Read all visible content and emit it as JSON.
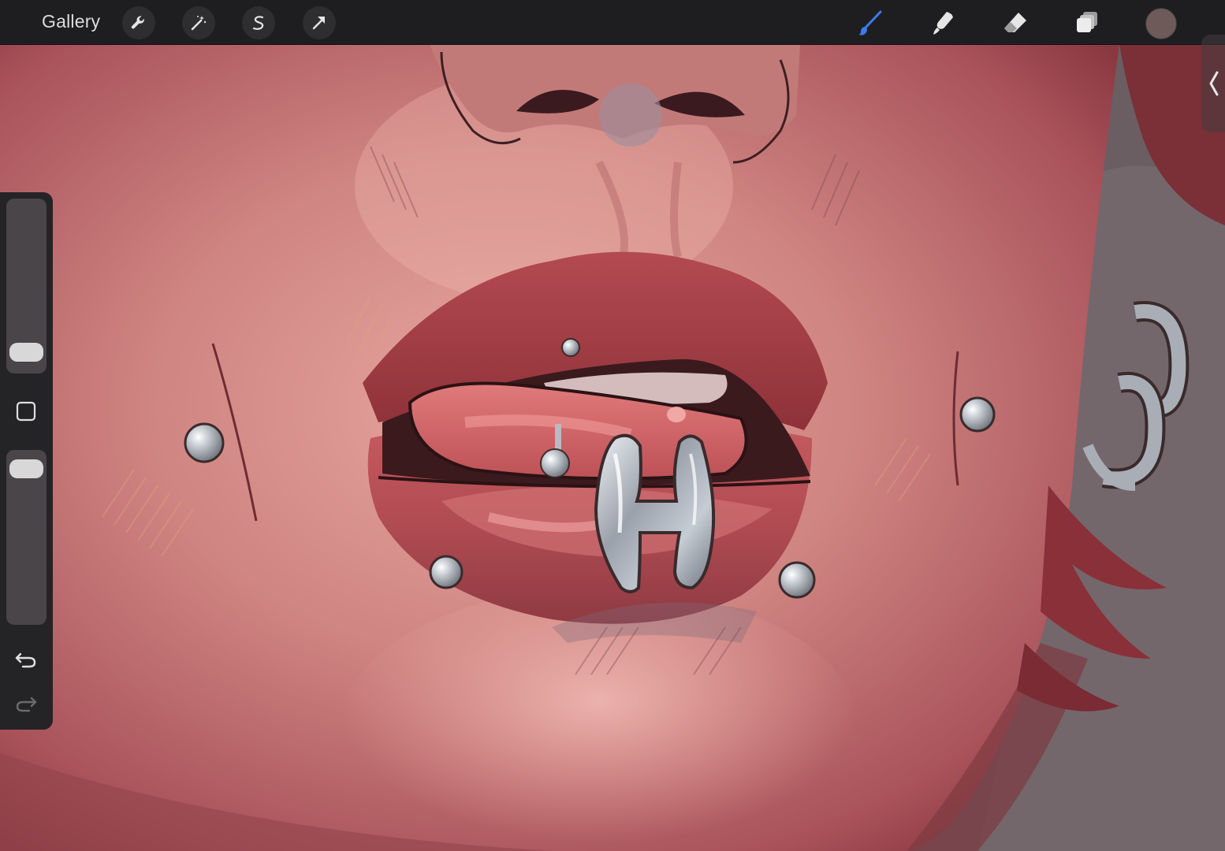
{
  "topbar": {
    "gallery_label": "Gallery",
    "left_tools": [
      "actions-icon",
      "adjustments-icon",
      "selection-icon",
      "transform-icon"
    ],
    "right_tools": [
      "brush-icon",
      "smudge-icon",
      "eraser-icon",
      "layers-icon"
    ],
    "active_tool": "brush-icon",
    "accent_color": "#3b7bf0",
    "current_color": "#6e5a58"
  },
  "sidebar": {
    "brush_size_level": 0.06,
    "opacity_level": 0.96,
    "buttons": [
      "modify-button",
      "undo-button",
      "redo-button"
    ]
  },
  "canvas": {
    "description_colors": {
      "skin": "#c97a78",
      "lip": "#a8454a",
      "tongue": "#d46a6c",
      "jewelry": "#9aa0a8",
      "background_gray": "#6a5e62"
    }
  }
}
